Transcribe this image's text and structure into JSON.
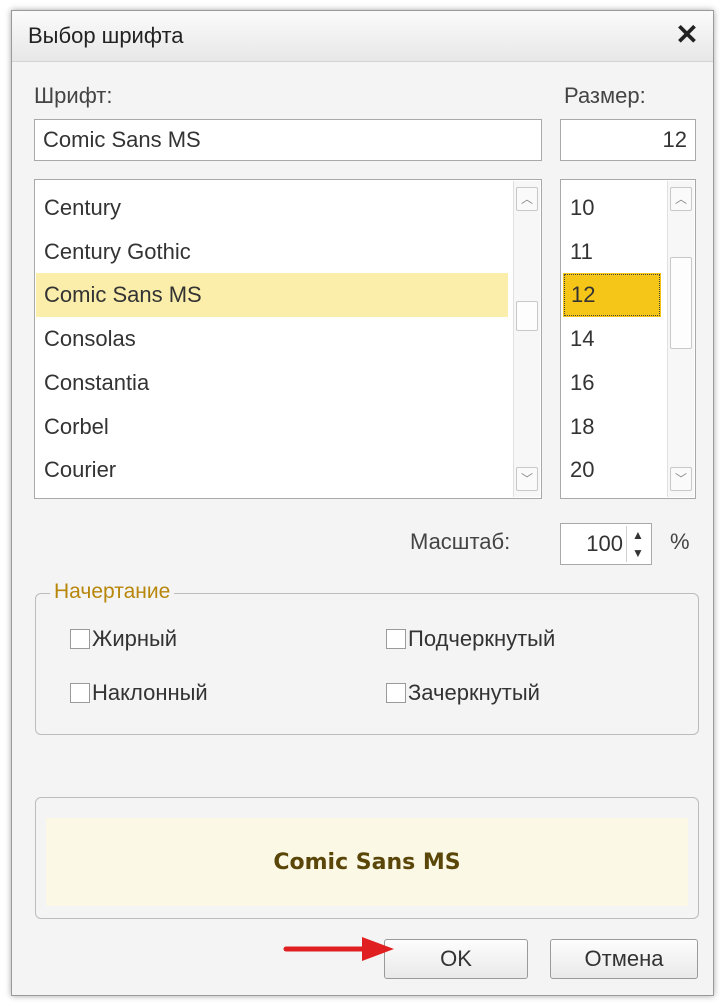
{
  "window": {
    "title": "Выбор шрифта"
  },
  "font": {
    "label": "Шрифт:",
    "value": "Comic Sans MS",
    "items": [
      "Century",
      "Century Gothic",
      "Comic Sans MS",
      "Consolas",
      "Constantia",
      "Corbel",
      "Courier"
    ],
    "selected": "Comic Sans MS"
  },
  "size": {
    "label": "Размер:",
    "value": "12",
    "items": [
      "10",
      "11",
      "12",
      "14",
      "16",
      "18",
      "20"
    ],
    "selected": "12"
  },
  "scale": {
    "label": "Масштаб:",
    "value": "100",
    "unit": "%"
  },
  "style_group": {
    "title": "Начертание",
    "bold": "Жирный",
    "underline": "Подчеркнутый",
    "italic": "Наклонный",
    "strikeout": "Зачеркнутый"
  },
  "preview": {
    "text": "Comic Sans MS"
  },
  "buttons": {
    "ok": "OK",
    "cancel": "Отмена"
  },
  "colors": {
    "selection_font": "#fbeeaa",
    "selection_size": "#f5c518",
    "group_title": "#b8860b",
    "arrow": "#e02020"
  }
}
